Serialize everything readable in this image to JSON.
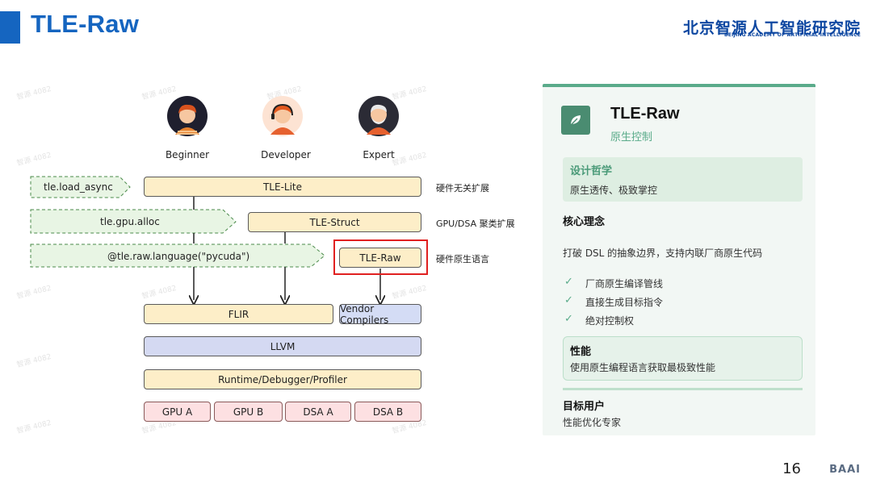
{
  "header": {
    "title": "TLE-Raw",
    "logo_cn": "北京智源人工智能研究院",
    "logo_en": "BEIJING ACADEMY OF ARTIFICIAL INTELLIGENCE"
  },
  "personas": [
    {
      "label": "Beginner"
    },
    {
      "label": "Developer"
    },
    {
      "label": "Expert"
    }
  ],
  "diagram": {
    "arrows": {
      "load_async": "tle.load_async",
      "gpu_alloc": "tle.gpu.alloc",
      "raw_language": "@tle.raw.language(\"pycuda\")"
    },
    "boxes": {
      "tle_lite": "TLE-Lite",
      "tle_struct": "TLE-Struct",
      "tle_raw": "TLE-Raw",
      "flir": "FLIR",
      "vendor_compilers": "Vendor Compilers",
      "llvm": "LLVM",
      "runtime": "Runtime/Debugger/Profiler"
    },
    "hardware": [
      "GPU A",
      "GPU B",
      "DSA A",
      "DSA B"
    ],
    "side_labels": [
      "硬件无关扩展",
      "GPU/DSA 聚类扩展",
      "硬件原生语言"
    ]
  },
  "panel": {
    "icon": "leaf-icon",
    "title": "TLE-Raw",
    "subtitle": "原生控制",
    "philosophy": {
      "heading": "设计哲学",
      "text": "原生透传、极致掌控"
    },
    "core": {
      "heading": "核心理念",
      "text": "打破 DSL 的抽象边界，支持内联厂商原生代码"
    },
    "checklist": [
      "厂商原生编译管线",
      "直接生成目标指令",
      "绝对控制权"
    ],
    "performance": {
      "heading": "性能",
      "text": "使用原生编程语言获取最极致性能"
    },
    "target": {
      "heading": "目标用户",
      "text": "性能优化专家"
    }
  },
  "footer": {
    "page": "16",
    "logo": "BAAI"
  },
  "watermark": "智源 4082",
  "colors": {
    "title_blue": "#1565c0",
    "accent_green": "#5aab8a",
    "highlight_red": "#e02020"
  }
}
